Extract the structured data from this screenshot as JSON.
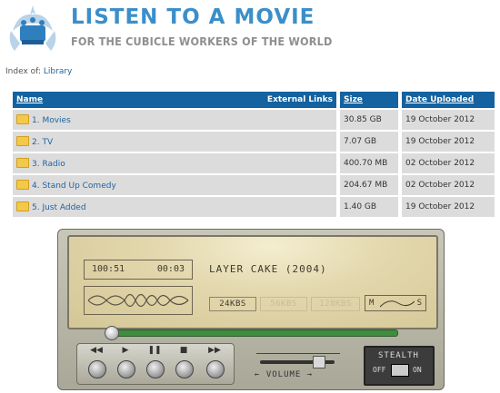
{
  "header": {
    "title": "LISTEN TO A MOVIE",
    "subtitle": "FOR THE CUBICLE WORKERS OF THE WORLD"
  },
  "breadcrumb": {
    "prefix": "Index of:",
    "link": "Library"
  },
  "table": {
    "headers": {
      "name": "Name",
      "external": "External Links",
      "size": "Size",
      "date": "Date Uploaded"
    },
    "rows": [
      {
        "name": "1. Movies",
        "size": "30.85 GB",
        "date": "19 October 2012"
      },
      {
        "name": "2. TV",
        "size": "7.07 GB",
        "date": "19 October 2012"
      },
      {
        "name": "3. Radio",
        "size": "400.70 MB",
        "date": "02 October 2012"
      },
      {
        "name": "4. Stand Up Comedy",
        "size": "204.67 MB",
        "date": "02 October 2012"
      },
      {
        "name": "5. Just Added",
        "size": "1.40 GB",
        "date": "19 October 2012"
      }
    ]
  },
  "player": {
    "time_elapsed": "100:51",
    "time_remaining": "00:03",
    "now_playing": "LAYER CAKE (2004)",
    "rates": [
      "24KBS",
      "56KBS",
      "128KBS"
    ],
    "ms_left": "M",
    "ms_right": "S",
    "progress": 0.02,
    "buttons": [
      "◀◀",
      "▶",
      "❚❚",
      "■",
      "▶▶"
    ],
    "volume_label": "← VOLUME →",
    "volume": 0.78,
    "stealth_label": "STEALTH",
    "stealth_off": "OFF",
    "stealth_on": "ON"
  },
  "colors": {
    "accent": "#3b8fc9",
    "header_bg": "#14629f",
    "row_bg": "#dcdcdc"
  }
}
